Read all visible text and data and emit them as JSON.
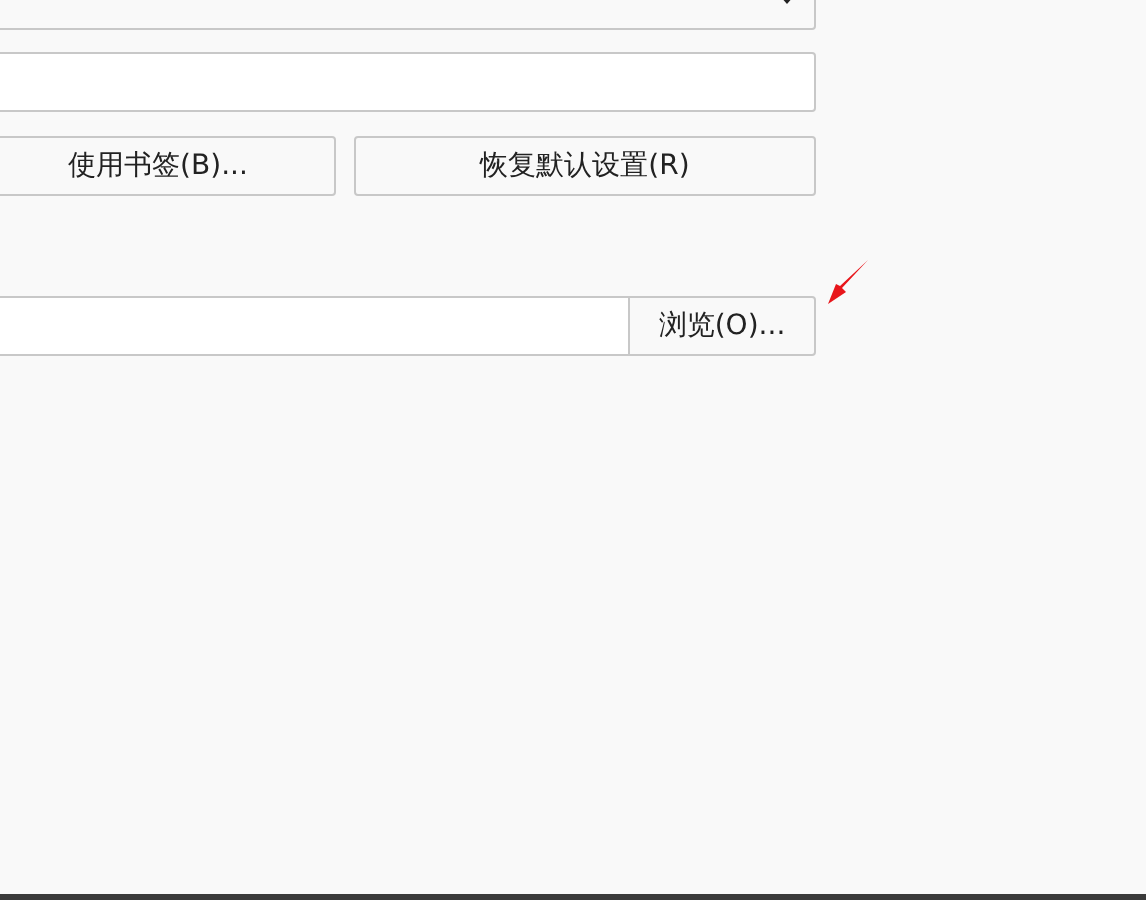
{
  "home_buttons": [
    {
      "label": "使用书签(B)..."
    },
    {
      "label": "恢复默认设置(R)"
    }
  ],
  "download_folder": {
    "browse_button": "浏览(O)..."
  }
}
